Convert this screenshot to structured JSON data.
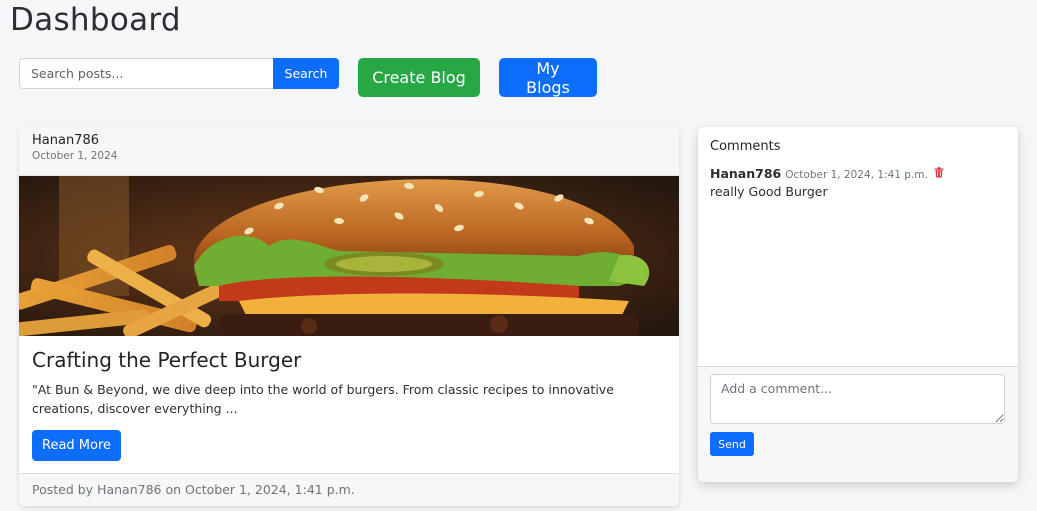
{
  "page": {
    "title": "Dashboard"
  },
  "search": {
    "placeholder": "Search posts...",
    "button_label": "Search"
  },
  "actions": {
    "create_blog_label": "Create Blog",
    "my_blogs_label": "My Blogs"
  },
  "post": {
    "author": "Hanan786",
    "date": "October 1, 2024",
    "title": "Crafting the Perfect Burger",
    "excerpt": "\"At Bun & Beyond, we dive deep into the world of burgers. From classic recipes to innovative creations, discover everything ...",
    "read_more_label": "Read More",
    "footer": "Posted by Hanan786 on October 1, 2024, 1:41 p.m."
  },
  "comments": {
    "heading": "Comments",
    "items": [
      {
        "author": "Hanan786",
        "time": "October 1, 2024, 1:41 p.m.",
        "text": "really Good Burger",
        "icon": "trash-icon"
      }
    ],
    "input_placeholder": "Add a comment...",
    "send_label": "Send"
  },
  "colors": {
    "primary": "#0d6efd",
    "success": "#28a745",
    "danger": "#dc3545"
  }
}
